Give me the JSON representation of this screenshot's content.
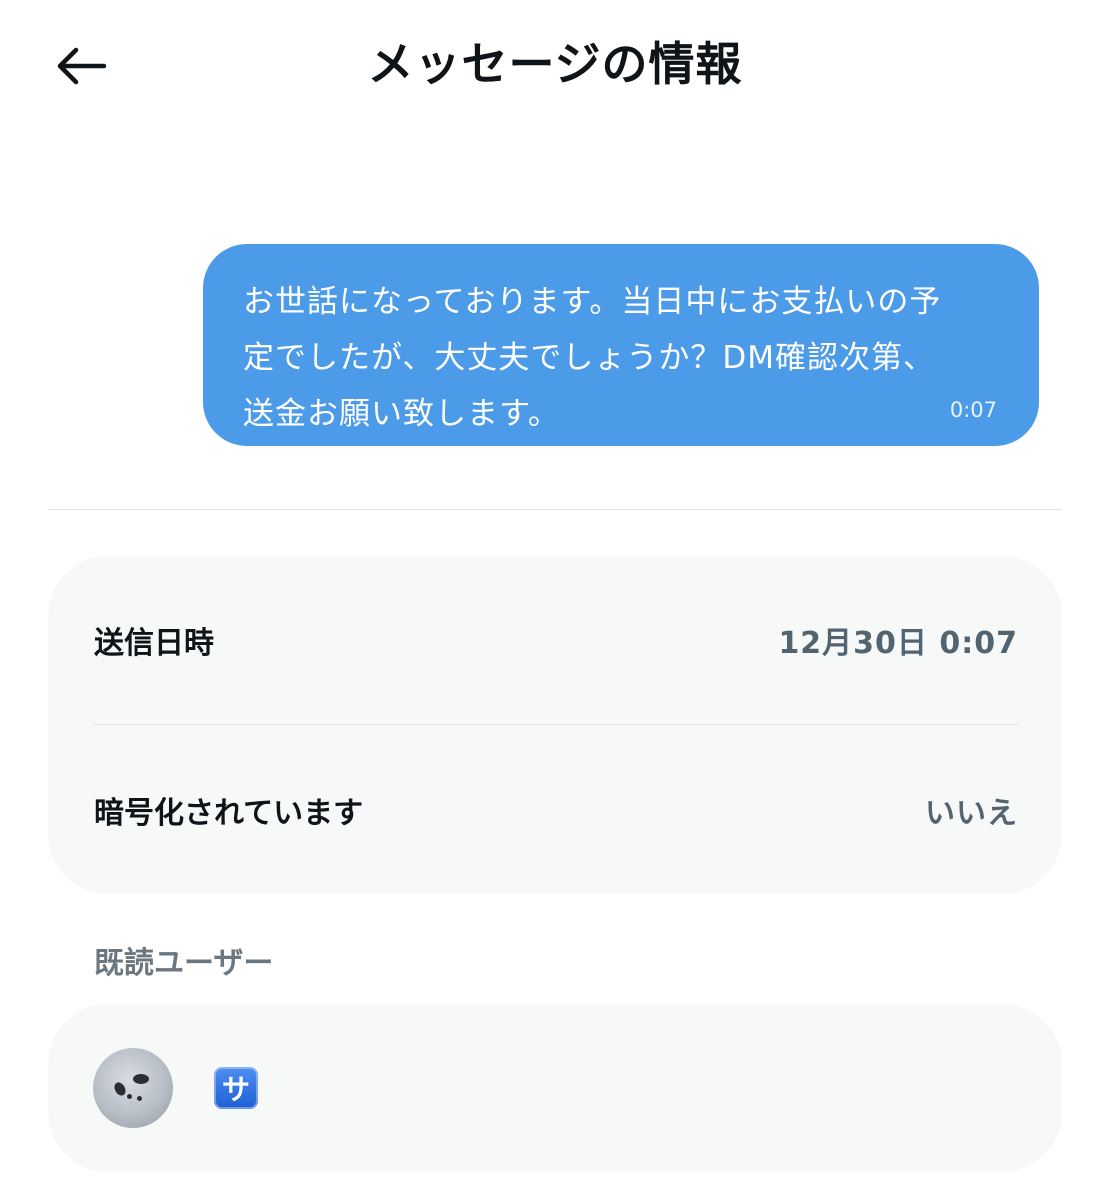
{
  "header": {
    "title": "メッセージの情報",
    "back_icon": "arrow-left-icon"
  },
  "message": {
    "text_lines": [
      "お世話になっております。当日中にお支払いの予",
      "定でしたが、大丈夫でしょうか？DM確認次第、",
      "送金お願い致します。"
    ],
    "time": "0:07",
    "bubble_color": "#4c9be8"
  },
  "details": {
    "sent_label": "送信日時",
    "sent_value": "12月30日 0:07",
    "encrypted_label": "暗号化されています",
    "encrypted_value": "いいえ"
  },
  "readers": {
    "section_title": "既読ユーザー",
    "users": [
      {
        "badge": "サ",
        "avatar_icon": "user-avatar"
      }
    ]
  }
}
